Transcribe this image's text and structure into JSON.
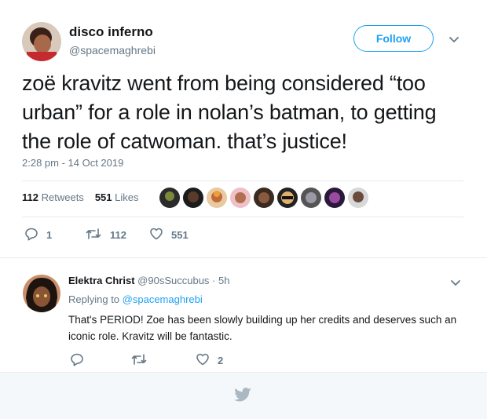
{
  "tweet": {
    "author_name": "disco inferno",
    "author_handle": "@spacemaghrebi",
    "follow_label": "Follow",
    "text": "zoë kravitz went from being considered “too urban” for a role in nolan’s batman, to getting the role of catwoman. that’s justice!",
    "timestamp": "2:28 pm - 14 Oct 2019",
    "retweets_count": "112",
    "retweets_label": "Retweets",
    "likes_count": "551",
    "likes_label": "Likes",
    "actions": {
      "reply_count": "1",
      "retweet_count": "112",
      "like_count": "551"
    },
    "icons": [
      "reply-icon",
      "retweet-icon",
      "heart-icon",
      "chevron-down-icon"
    ]
  },
  "reply": {
    "author_name": "Elektra Christ",
    "author_handle": "@90sSuccubus",
    "time": "· 5h",
    "replying_prefix": "Replying to",
    "replying_handle": "@spacemaghrebi",
    "text": "That's PERIOD! Zoe has been slowly building up her credits and deserves such an iconic role. Kravitz will be fantastic.",
    "actions": {
      "like_count": "2"
    }
  },
  "colors": {
    "accent": "#1da1f2",
    "secondary_text": "#657786",
    "primary_text": "#14171a",
    "footer_bg": "#f5f8fa",
    "icon_gray": "#aab8c2"
  }
}
